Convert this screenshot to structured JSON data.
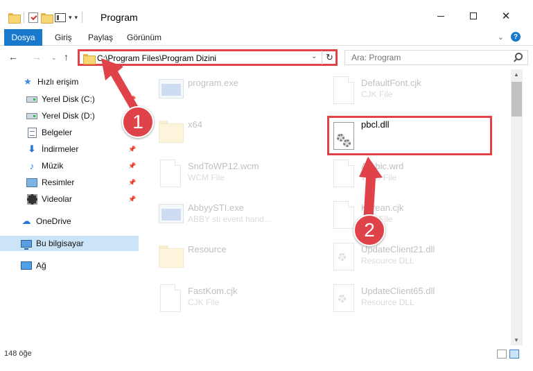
{
  "window": {
    "title": "Program"
  },
  "ribbon": {
    "tabs": [
      "Dosya",
      "Giriş",
      "Paylaş",
      "Görünüm"
    ],
    "help": "?"
  },
  "address": {
    "path": "C:\\Program Files\\Program Dizini"
  },
  "search": {
    "placeholder": "Ara: Program"
  },
  "sidebar": {
    "items": [
      {
        "label": "Hızlı erişim",
        "icon": "star-icon"
      },
      {
        "label": "Yerel Disk (C:)",
        "icon": "drive-icon",
        "pinned": true
      },
      {
        "label": "Yerel Disk (D:)",
        "icon": "drive-icon"
      },
      {
        "label": "Belgeler",
        "icon": "documents-icon"
      },
      {
        "label": "İndirmeler",
        "icon": "download-icon",
        "pinned": true
      },
      {
        "label": "Müzik",
        "icon": "music-icon",
        "pinned": true
      },
      {
        "label": "Resimler",
        "icon": "pictures-icon",
        "pinned": true
      },
      {
        "label": "Videolar",
        "icon": "videos-icon",
        "pinned": true
      },
      {
        "label": "OneDrive",
        "icon": "onedrive-icon"
      },
      {
        "label": "Bu bilgisayar",
        "icon": "computer-icon",
        "selected": true
      },
      {
        "label": "Ağ",
        "icon": "network-icon"
      }
    ]
  },
  "files": {
    "left": [
      {
        "name": "program.exe",
        "type": ""
      },
      {
        "name": "x64",
        "type": ""
      },
      {
        "name": "SndToWP12.wcm",
        "type": "WCM File"
      },
      {
        "name": "AbbyySTI.exe",
        "type": "ABBY sti event hand..."
      },
      {
        "name": "Resource",
        "type": ""
      },
      {
        "name": "FastKom.cjk",
        "type": "CJK File"
      }
    ],
    "right": [
      {
        "name": "DefaultFont.cjk",
        "type": "CJK File"
      },
      {
        "name": "pbcl.dll",
        "type": ""
      },
      {
        "name": "Arabic.wrd",
        "type": "WRD File"
      },
      {
        "name": "Korean.cjk",
        "type": "CJK File"
      },
      {
        "name": "UpdateClient21.dll",
        "type": "Resource DLL"
      },
      {
        "name": "UpdateClient65.dll",
        "type": "Resource DLL"
      }
    ]
  },
  "status": {
    "count": "148 öğe"
  },
  "annotations": {
    "badge1": "1",
    "badge2": "2"
  },
  "colors": {
    "accent": "#1979ca",
    "highlight": "#e0424a"
  }
}
